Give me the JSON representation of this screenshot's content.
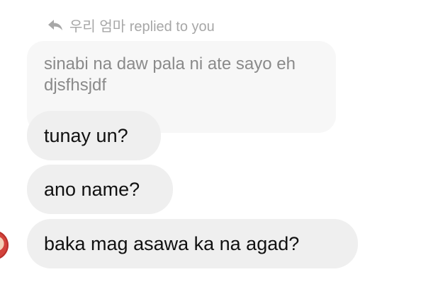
{
  "reply": {
    "icon": "reply-arrow-icon",
    "text": "우리 엄마 replied to you"
  },
  "quoted_message": "sinabi na daw pala ni ate sayo eh djsfhsjdf",
  "messages": [
    "tunay un?",
    "ano name?",
    "baka mag asawa ka na agad?"
  ],
  "colors": {
    "quoted_bubble_bg": "#f7f7f7",
    "message_bubble_bg": "#efefef",
    "quoted_text": "#8a8a8a",
    "meta_text": "#a7a7a7",
    "message_text": "#111111"
  }
}
